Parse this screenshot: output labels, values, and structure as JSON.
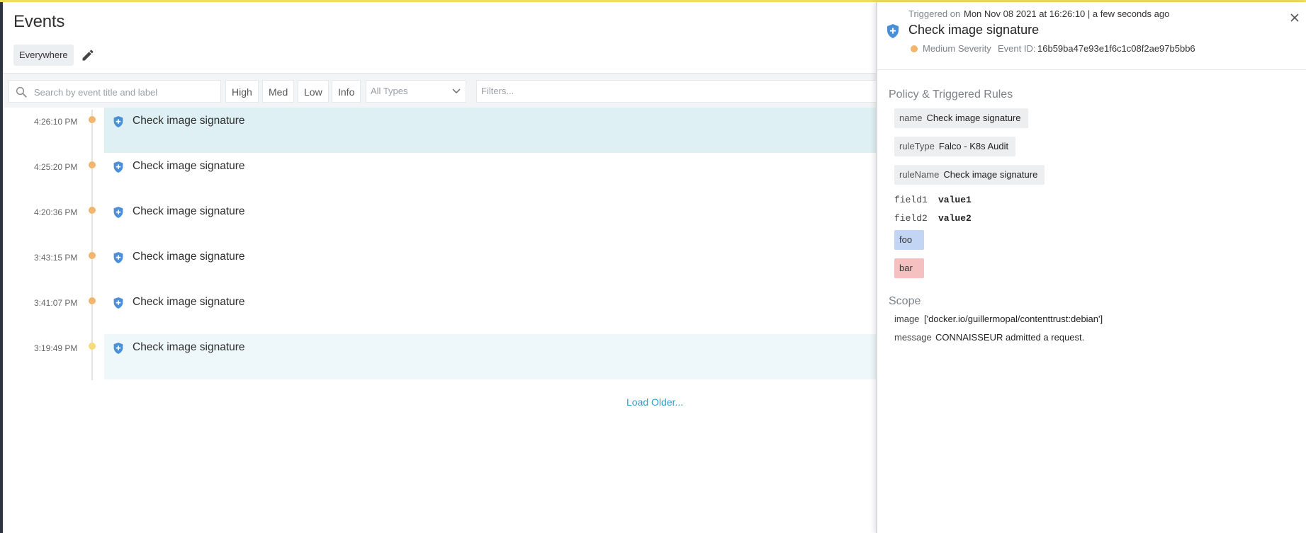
{
  "main": {
    "title": "Events",
    "scope": "Everywhere",
    "search_placeholder": "Search by event title and label",
    "severity_buttons": [
      "High",
      "Med",
      "Low",
      "Info"
    ],
    "type_select": "All Types",
    "filters_placeholder": "Filters...",
    "load_older": "Load Older..."
  },
  "events": [
    {
      "time": "4:26:10 PM",
      "title": "Check image signature",
      "dot_color": "#f2b56b",
      "state": "selected"
    },
    {
      "time": "4:25:20 PM",
      "title": "Check image signature",
      "dot_color": "#f2b56b",
      "state": ""
    },
    {
      "time": "4:20:36 PM",
      "title": "Check image signature",
      "dot_color": "#f2b56b",
      "state": ""
    },
    {
      "time": "3:43:15 PM",
      "title": "Check image signature",
      "dot_color": "#f2b56b",
      "state": ""
    },
    {
      "time": "3:41:07 PM",
      "title": "Check image signature",
      "dot_color": "#f2b56b",
      "state": ""
    },
    {
      "time": "3:19:49 PM",
      "title": "Check image signature",
      "dot_color": "#f6dc78",
      "state": "highlight"
    }
  ],
  "detail": {
    "triggered_label": "Triggered on",
    "triggered_value": "Mon Nov 08 2021 at 16:26:10 | a few seconds ago",
    "title": "Check image signature",
    "severity": "Medium Severity",
    "severity_color": "#f2b56b",
    "event_id_label": "Event ID:",
    "event_id": "16b59ba47e93e1f6c1c08f2ae97b5bb6",
    "policy_section": "Policy & Triggered Rules",
    "policy": [
      {
        "key": "name",
        "value": "Check image signature"
      },
      {
        "key": "ruleType",
        "value": "Falco - K8s Audit"
      },
      {
        "key": "ruleName",
        "value": "Check image signature"
      }
    ],
    "fields": [
      {
        "key": "field1",
        "value": "value1"
      },
      {
        "key": "field2",
        "value": "value2"
      }
    ],
    "tags": [
      {
        "label": "foo",
        "color": "#c2d5f5"
      },
      {
        "label": "bar",
        "color": "#f5c0c0"
      }
    ],
    "scope_section": "Scope",
    "scope": [
      {
        "key": "image",
        "value": "['docker.io/guillermopal/contenttrust:debian']"
      },
      {
        "key": "message",
        "value": "CONNAISSEUR admitted a request."
      }
    ]
  },
  "colors": {
    "accent_link": "#2f9ec4",
    "shield": "#4a90d9",
    "selected_row": "#def0f4",
    "top_bar": "#f2dc5a"
  },
  "icons": [
    "search-icon",
    "pencil-icon",
    "chevron-down-icon",
    "shield-icon",
    "close-icon"
  ]
}
